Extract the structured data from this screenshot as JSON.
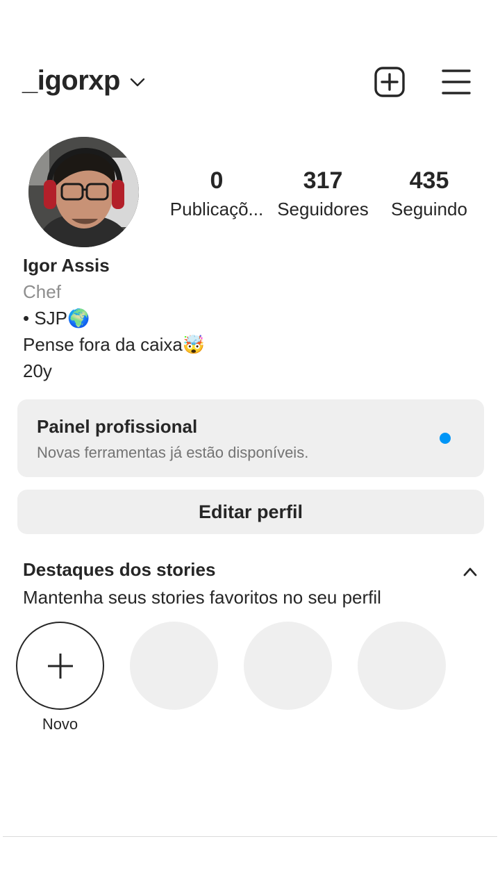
{
  "header": {
    "username": "_igorxp",
    "icons": [
      "chevron-down-icon",
      "new-post-icon",
      "menu-icon"
    ]
  },
  "stats": [
    {
      "value": "0",
      "label": "Publicaçõ..."
    },
    {
      "value": "317",
      "label": "Seguidores"
    },
    {
      "value": "435",
      "label": "Seguindo"
    }
  ],
  "bio": {
    "name": "Igor Assis",
    "category": "Chef",
    "lines": [
      "• SJP🌍",
      "Pense fora da caixa🤯",
      "20y"
    ]
  },
  "panel": {
    "title": "Painel profissional",
    "subtitle": "Novas ferramentas já estão disponíveis.",
    "dot_color": "#0095f6"
  },
  "edit_button": "Editar perfil",
  "highlights": {
    "title": "Destaques dos stories",
    "subtitle": "Mantenha seus stories favoritos no seu perfil",
    "new_label": "Novo"
  },
  "colors": {
    "text": "#262626",
    "secondary": "#8e8e8e",
    "button_bg": "#efefef",
    "accent": "#0095f6"
  }
}
